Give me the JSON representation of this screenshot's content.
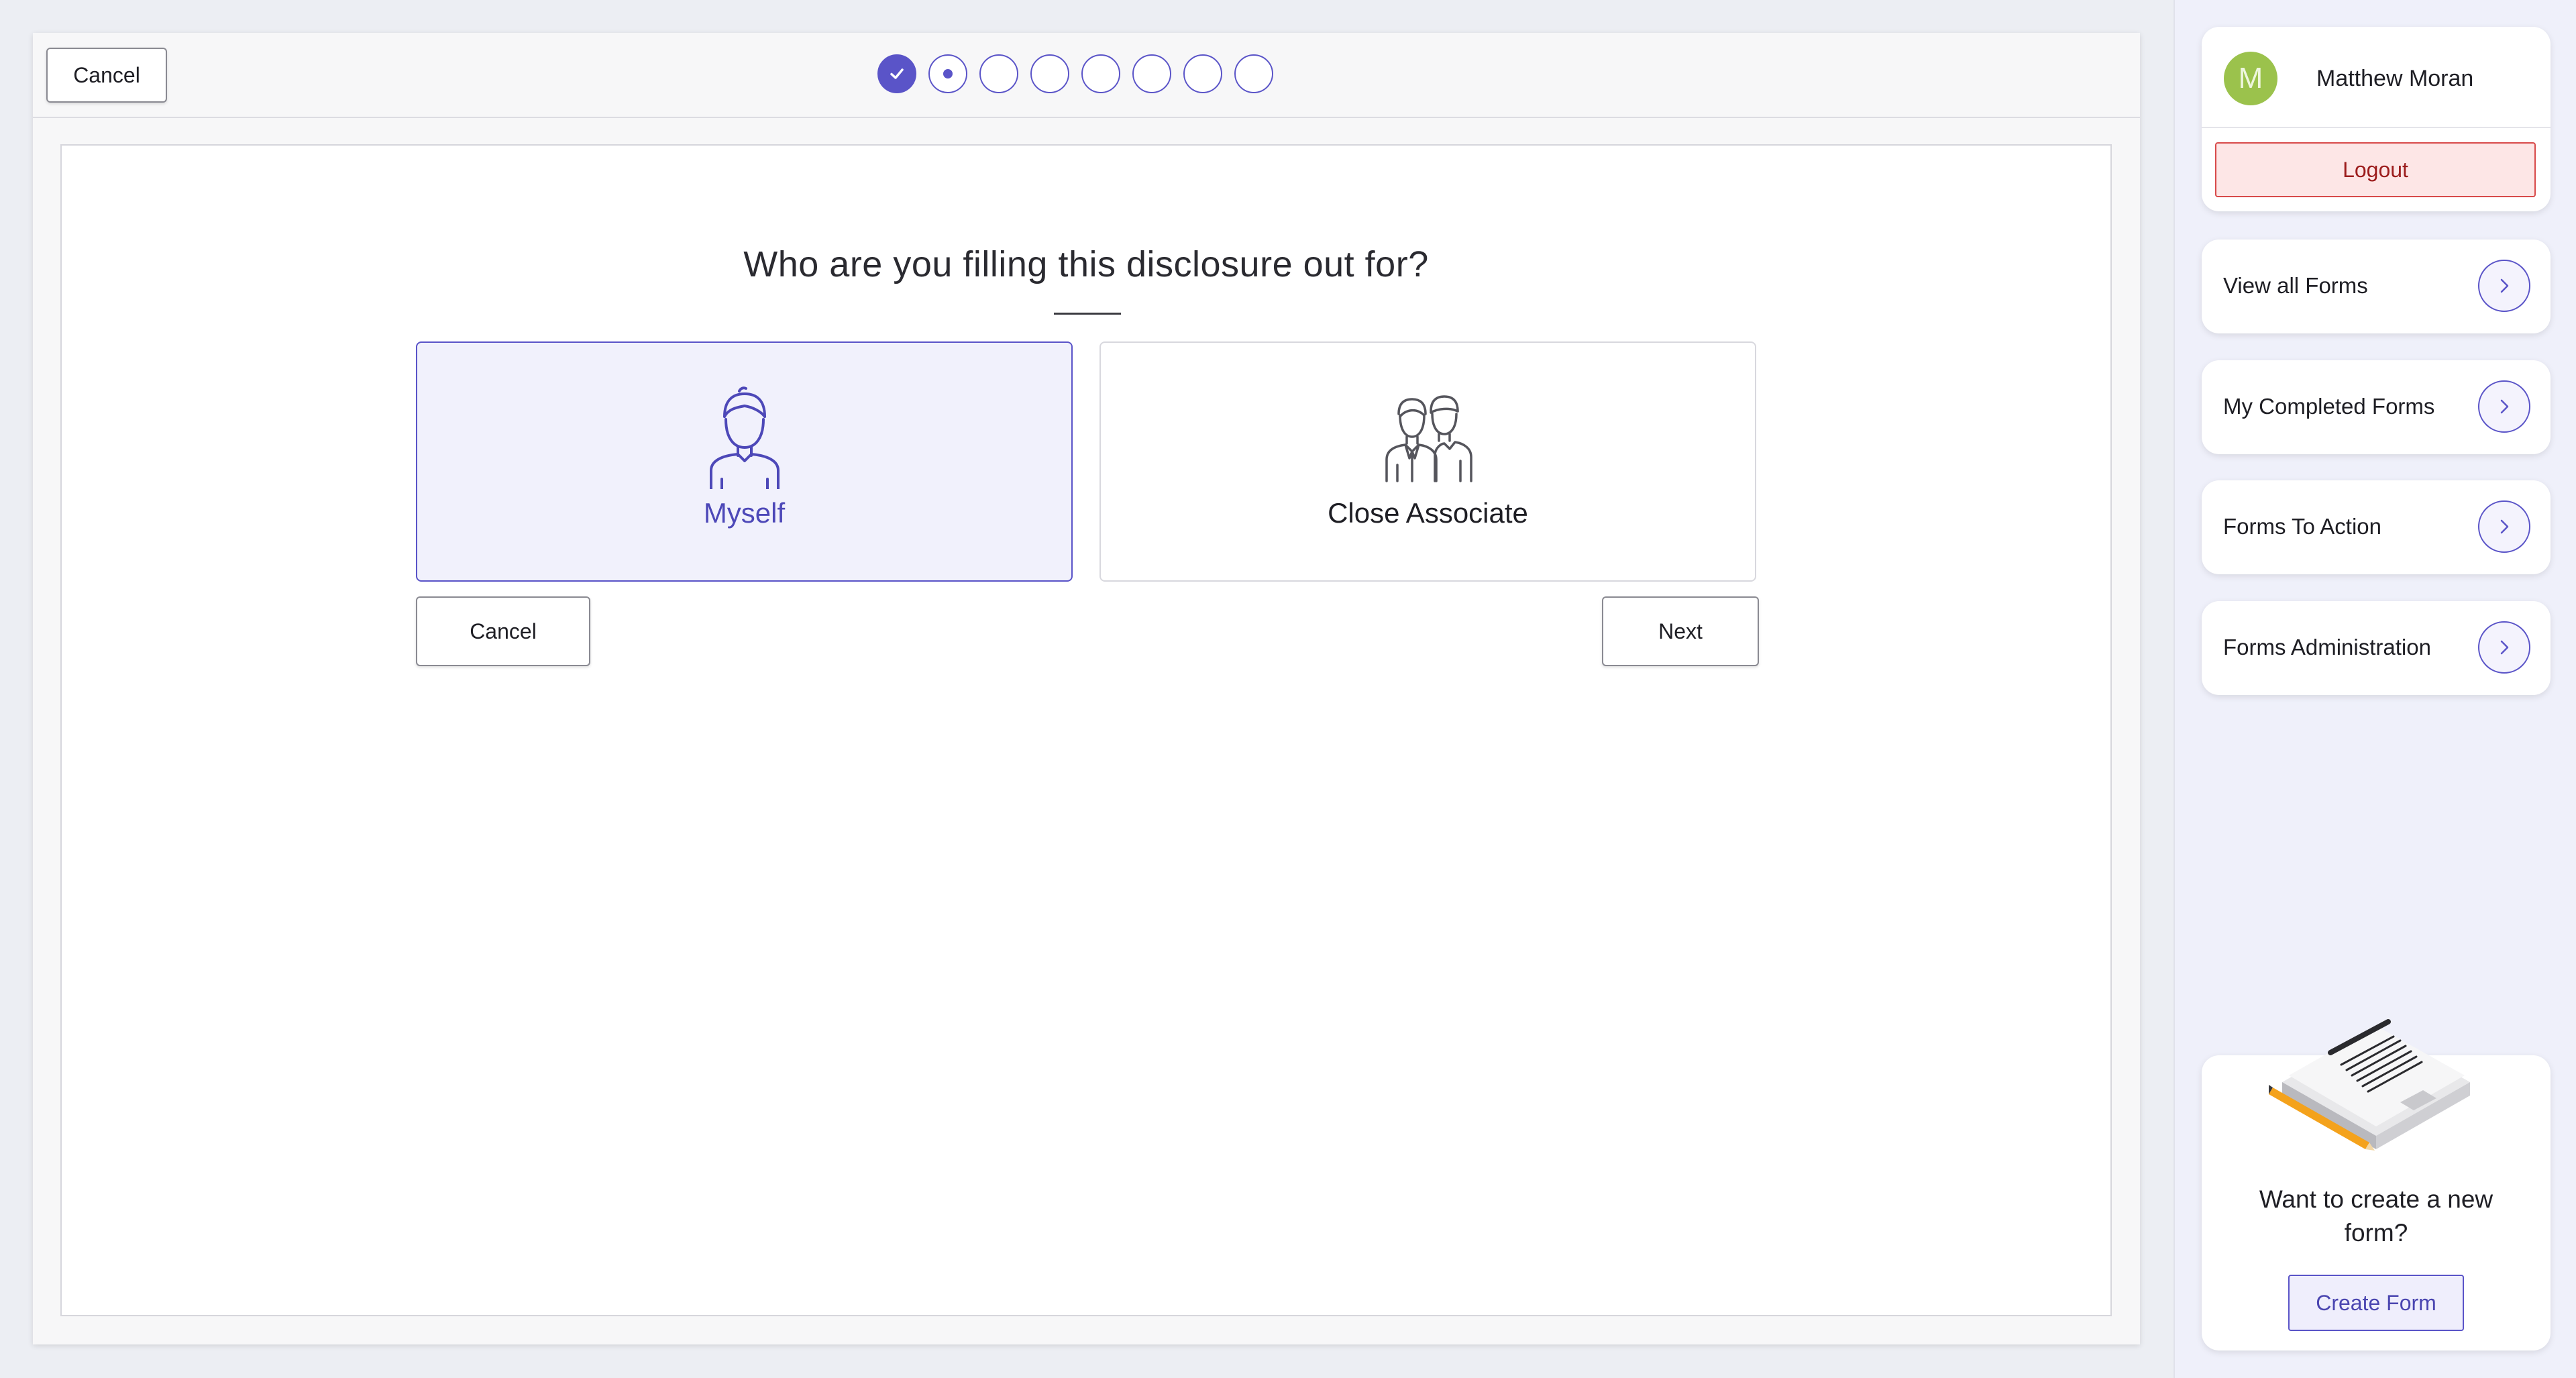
{
  "header": {
    "cancel_label": "Cancel",
    "steps": [
      {
        "state": "completed",
        "icon": "check-icon"
      },
      {
        "state": "current"
      },
      {
        "state": "pending"
      },
      {
        "state": "pending"
      },
      {
        "state": "pending"
      },
      {
        "state": "pending"
      },
      {
        "state": "pending"
      },
      {
        "state": "pending"
      }
    ]
  },
  "form": {
    "question": "Who are you filling this disclosure out for?",
    "options": [
      {
        "label": "Myself",
        "icon": "person-icon",
        "selected": true
      },
      {
        "label": "Close Associate",
        "icon": "two-people-icon",
        "selected": false
      }
    ],
    "cancel_label": "Cancel",
    "next_label": "Next"
  },
  "sidebar": {
    "user": {
      "initial": "M",
      "name": "Matthew Moran",
      "avatar_color": "#9bc24c"
    },
    "logout_label": "Logout",
    "nav": [
      {
        "label": "View all Forms",
        "icon": "chevron-right-icon"
      },
      {
        "label": "My Completed Forms",
        "icon": "chevron-right-icon"
      },
      {
        "label": "Forms To Action",
        "icon": "chevron-right-icon"
      },
      {
        "label": "Forms Administration",
        "icon": "chevron-right-icon"
      }
    ],
    "create": {
      "prompt": "Want to create a new form?",
      "button_label": "Create Form",
      "illustration": "document-pencil-illustration"
    }
  },
  "colors": {
    "accent": "#5a54c8",
    "logout_border": "#d84a4a",
    "logout_bg": "#fde6e6"
  }
}
